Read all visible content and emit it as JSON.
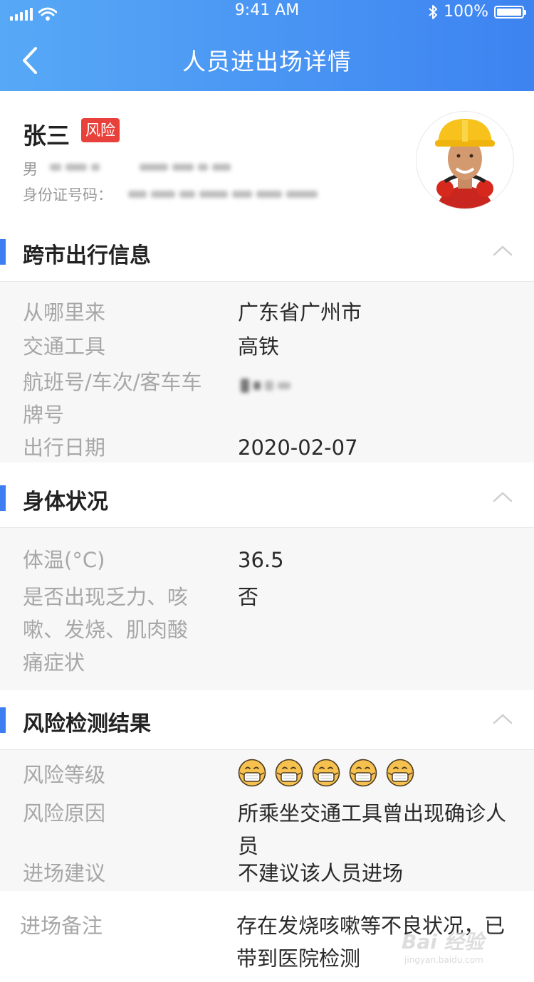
{
  "status_bar": {
    "time": "9:41 AM",
    "battery": "100%",
    "battery_level": 1.0
  },
  "nav": {
    "title": "人员进出场详情"
  },
  "person": {
    "name": "张三",
    "tag": "风险",
    "gender": "男",
    "id_label": "身份证号码："
  },
  "sections": {
    "travel": {
      "title": "跨市出行信息",
      "rows": [
        {
          "label": "从哪里来",
          "value": "广东省广州市"
        },
        {
          "label": "交通工具",
          "value": "高铁"
        },
        {
          "label": "航班号/车次/客车车牌号",
          "value": ""
        },
        {
          "label": "出行日期",
          "value": "2020-02-07"
        }
      ]
    },
    "health": {
      "title": "身体状况",
      "rows": [
        {
          "label": "体温(°C)",
          "value": "36.5"
        },
        {
          "label": "是否出现乏力、咳嗽、发烧、肌肉酸痛症状",
          "value": "否"
        }
      ]
    },
    "risk": {
      "title": "风险检测结果",
      "rows": [
        {
          "label": "风险等级",
          "value": "",
          "level": 5,
          "icon": "masked-face-icon"
        },
        {
          "label": "风险原因",
          "value": "所乘坐交通工具曾出现确诊人员"
        },
        {
          "label": "进场建议",
          "value": "不建议该人员进场"
        }
      ]
    }
  },
  "remark": {
    "label": "进场备注",
    "value": "存在发烧咳嗽等不良状况，已带到医院检测"
  },
  "watermark": {
    "logo": "Bai 经验",
    "url": "jingyan.baidu.com"
  },
  "colors": {
    "header_gradient_start": "#57a9f6",
    "header_gradient_end": "#3d83f1",
    "accent_bar": "#3d7ef0",
    "risk_tag": "#e8413b",
    "face_icon": "#f6c14e"
  }
}
